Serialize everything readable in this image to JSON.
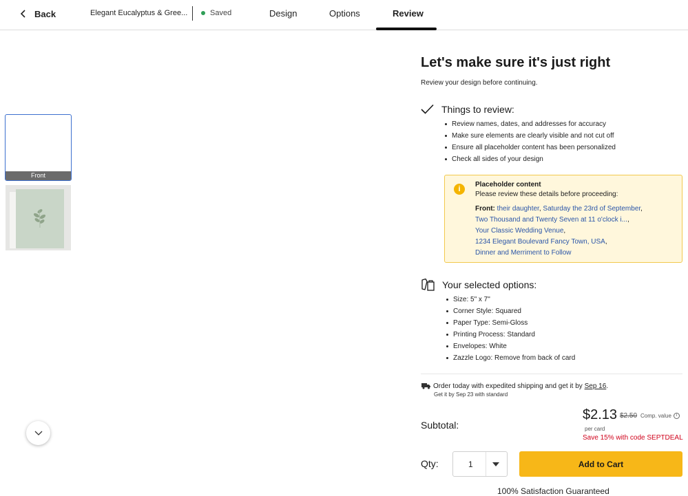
{
  "nav": {
    "back_label": "Back",
    "doc_name": "Elegant Eucalyptus & Gree...",
    "saved_label": "Saved",
    "tabs": [
      {
        "label": "Design"
      },
      {
        "label": "Options"
      },
      {
        "label": "Review",
        "active": true
      }
    ]
  },
  "thumbnails": {
    "front_label": "Front"
  },
  "review": {
    "headline": "Let's make sure it's just right",
    "subhead": "Review your design before continuing.",
    "things_title": "Things to review:",
    "things": [
      "Review names, dates, and addresses for accuracy",
      "Make sure elements are clearly visible and not cut off",
      "Ensure all placeholder content has been personalized",
      "Check all sides of your design"
    ]
  },
  "placeholder": {
    "title": "Placeholder content",
    "description": "Please review these details before proceeding:",
    "front_label": "Front:",
    "links": [
      "their daughter",
      "Saturday the 23rd of September",
      "Two Thousand and Twenty Seven at 11 o'clock i...",
      "Your Classic Wedding Venue",
      "1234 Elegant Boulevard Fancy Town, USA",
      "Dinner and Merriment to Follow"
    ]
  },
  "options": {
    "title": "Your selected options:",
    "items": [
      "Size: 5\" x 7\"",
      "Corner Style: Squared",
      "Paper Type: Semi-Gloss",
      "Printing Process: Standard",
      "Envelopes: White",
      "Zazzle Logo: Remove from back of card"
    ]
  },
  "shipping": {
    "main_prefix": "Order today with expedited shipping and get it by ",
    "main_date": "Sep 16",
    "main_suffix": ".",
    "sub": "Get it by Sep 23 with standard"
  },
  "pricing": {
    "subtotal_label": "Subtotal:",
    "price": "$2.13",
    "old_price": "$2.50",
    "comp_value": "Comp. value",
    "per_card": "per card",
    "promo": "Save 15% with code SEPTDEAL"
  },
  "cart": {
    "qty_label": "Qty:",
    "qty_value": "1",
    "add_to_cart": "Add to Cart",
    "guarantee": "100% Satisfaction Guaranteed"
  },
  "colors": {
    "accent_yellow": "#f7b718",
    "link_blue": "#2a55a8",
    "promo_red": "#d0021b",
    "saved_green": "#2f9e57",
    "selected_border": "#3c6fcf"
  },
  "icons": {
    "back": "chevron-left-icon",
    "review": "checkmark-icon",
    "options": "product-options-icon",
    "warning": "info-warning-icon",
    "shipping": "truck-icon",
    "scroll": "chevron-down-icon"
  }
}
